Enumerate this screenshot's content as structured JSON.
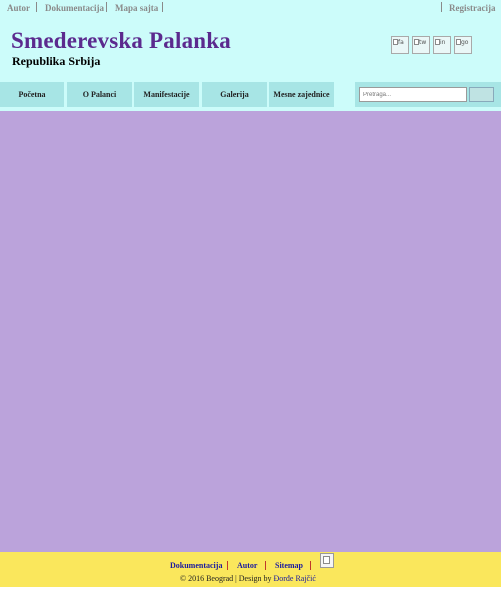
{
  "topbar": {
    "left_links": [
      "Autor",
      "Dokumentacija",
      "Mapa sajta"
    ],
    "right_link": "Registracija"
  },
  "header": {
    "title": "Smederevska Palanka",
    "subtitle": "Republika Srbija"
  },
  "social": [
    {
      "icon": "facebook-icon",
      "alt": "fa"
    },
    {
      "icon": "twitter-icon",
      "alt": "tw"
    },
    {
      "icon": "instagram-icon",
      "alt": "in"
    },
    {
      "icon": "google-plus-icon",
      "alt": "go"
    }
  ],
  "nav": [
    "Početna",
    "O Palanci",
    "Manifestacije",
    "Galerija",
    "Mesne zajednice"
  ],
  "search": {
    "placeholder": "Pretraga..."
  },
  "footer": {
    "links": [
      "Dokumentacija",
      "Autor",
      "Sitemap"
    ],
    "copyright_prefix": "© 2016 Beograd | Design by ",
    "author": "Đorđe Rajčić"
  },
  "colors": {
    "header_bg": "#ccfcfa",
    "nav_bg": "#a7e5e5",
    "title": "#5b2a8e",
    "main_bg": "#bba3db",
    "footer_bg": "#fae75c",
    "footer_link": "#1a1aa0",
    "footer_separator": "#c0392b"
  }
}
